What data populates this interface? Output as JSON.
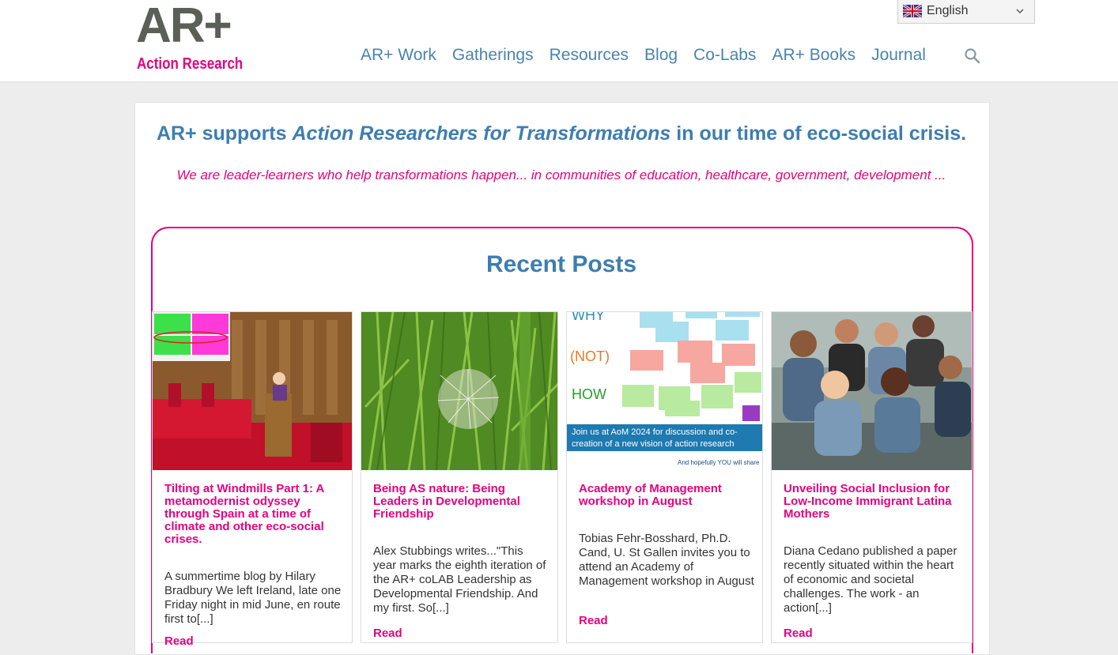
{
  "logo": {
    "main": "AR+",
    "sub": "Action Research"
  },
  "language": {
    "label": "English",
    "code": "en"
  },
  "nav": {
    "items": [
      "AR+ Work",
      "Gatherings",
      "Resources",
      "Blog",
      "Co-Labs",
      "AR+ Books",
      "Journal"
    ]
  },
  "hero": {
    "headline_start": "AR+ supports ",
    "headline_em": "Action Researchers for Transformations",
    "headline_end": " in our time of eco-social crisis.",
    "subline": "We are leader-learners who help transformations happen... in communities of education, healthcare, government, development ..."
  },
  "recent": {
    "title": "Recent Posts"
  },
  "posts": [
    {
      "title": "Tilting at Windmills Part 1: A metamodernist odyssey through Spain at a time of climate and other eco-social crises.",
      "excerpt": "A summertime blog by Hilary Bradbury  We left Ireland, late one Friday night in mid June, en route first to[...]",
      "read": "Read"
    },
    {
      "title": "Being AS nature: Being Leaders in Developmental Friendship",
      "excerpt": "Alex Stubbings writes...\"This year marks the eighth iteration of the AR+ coLAB  Leadership as Developmental Friendship. And my first. So[...]",
      "read": "Read"
    },
    {
      "title": "Academy of Management workshop in August",
      "excerpt": "Tobias Fehr-Bosshard, Ph.D. Cand, U. St Gallen invites you to attend an Academy of Management workshop in August",
      "read": "Read",
      "image_text": {
        "why": "WHY",
        "not": "(NOT)",
        "how": "HOW",
        "banner": "Join us at AoM 2024 for discussion and co-creation of a new vision of action research",
        "footer": "And hopefully YOU will share"
      }
    },
    {
      "title": "Unveiling Social Inclusion for Low-Income Immigrant Latina Mothers",
      "excerpt": "Diana Cedano published a paper recently situated within the heart of economic and societal challenges. The work - an action[...]",
      "read": "Read"
    }
  ],
  "colors": {
    "brand_pink": "#e6007e",
    "brand_blue": "#3d7eb0",
    "logo_gray": "#5a5f57"
  }
}
